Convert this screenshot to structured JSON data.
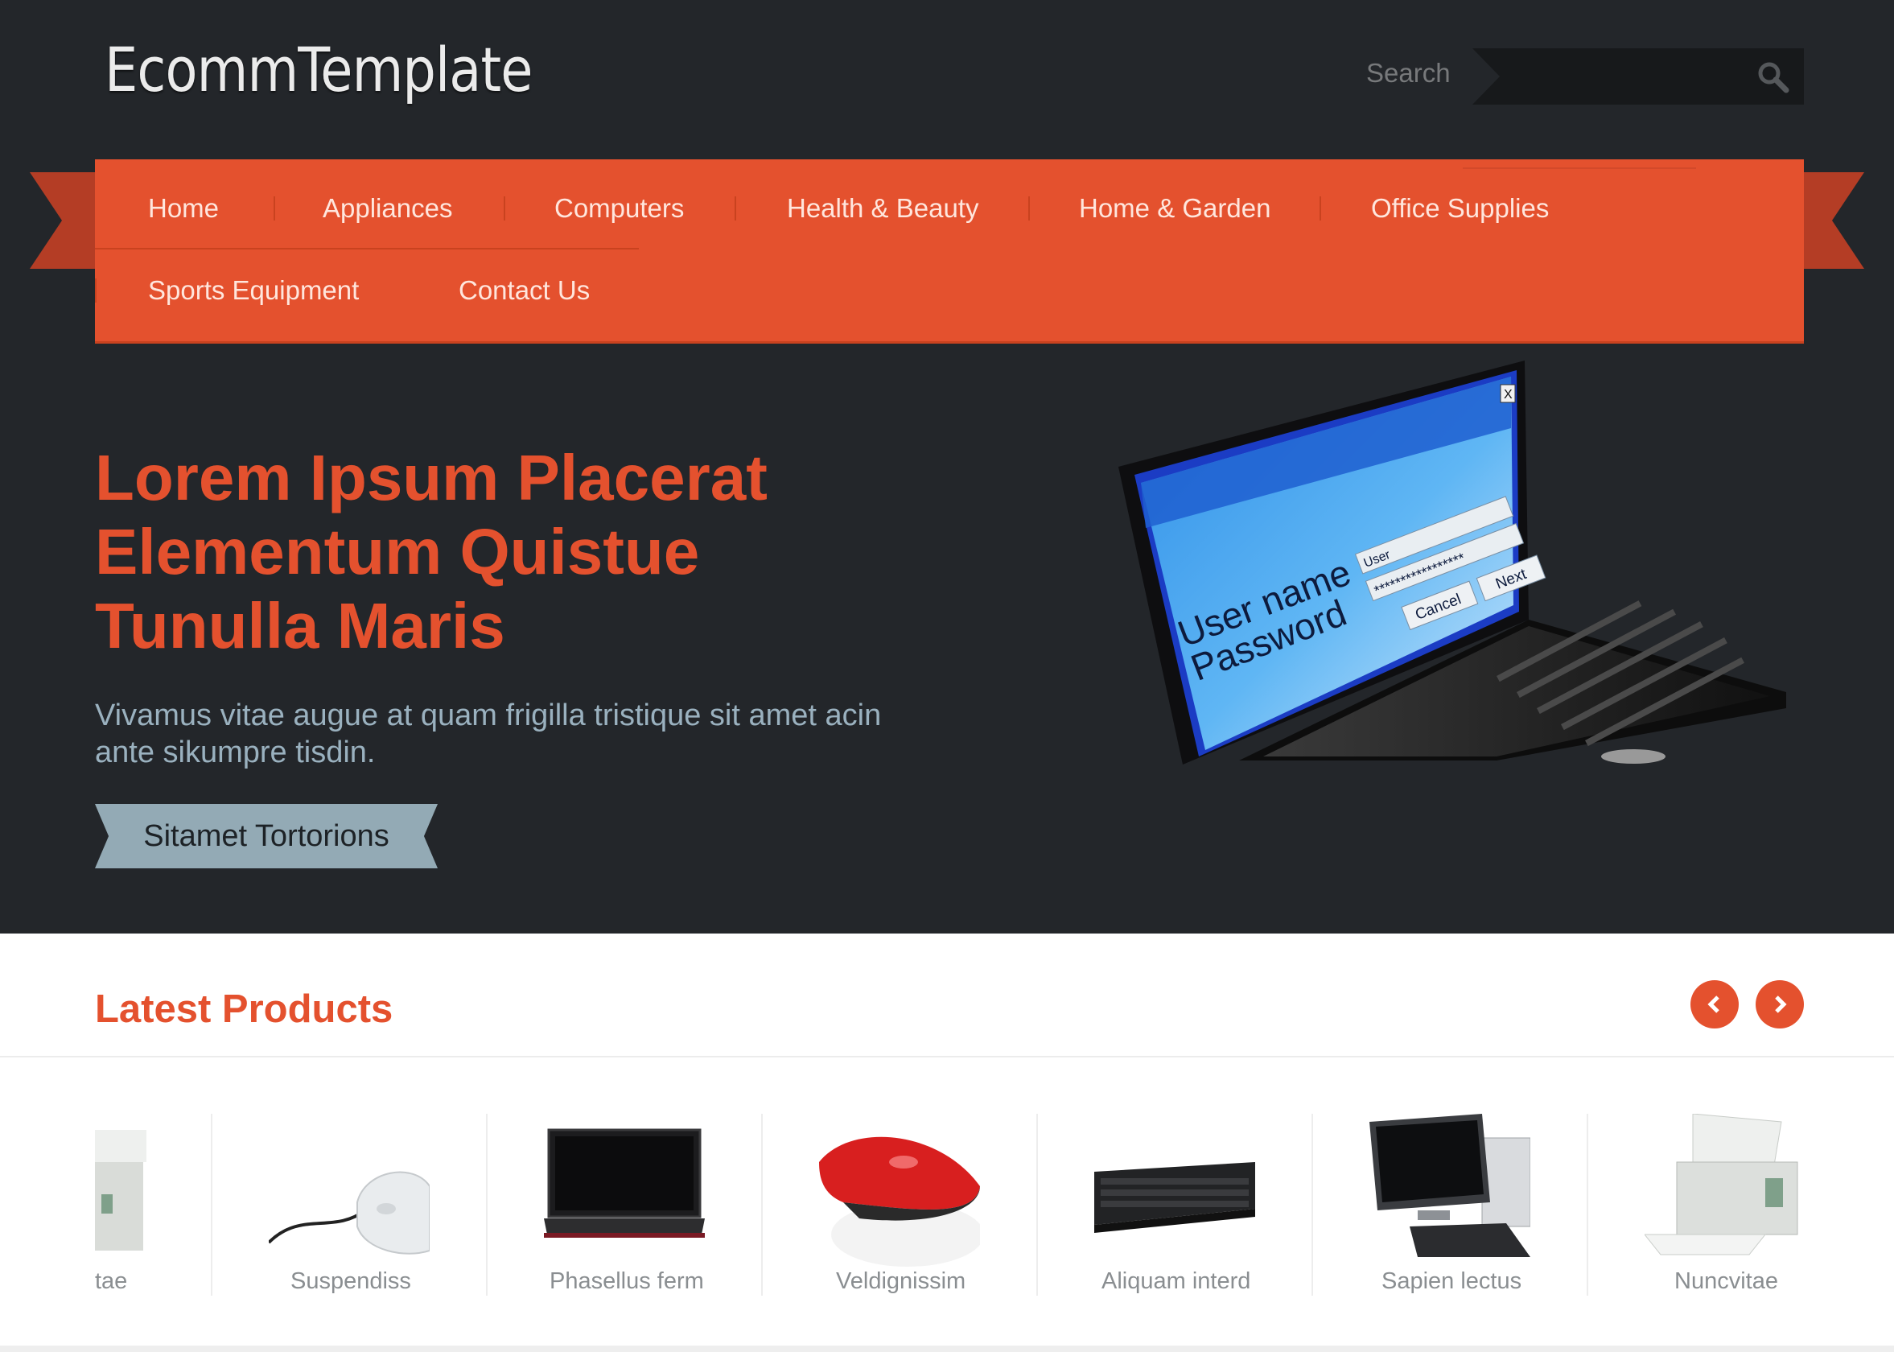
{
  "header": {
    "logo": "EcommTemplate",
    "search_label": "Search",
    "search_placeholder": ""
  },
  "nav": {
    "items": [
      "Home",
      "Appliances",
      "Computers",
      "Health & Beauty",
      "Home & Garden",
      "Office Supplies",
      "Sports Equipment",
      "Contact Us"
    ]
  },
  "hero": {
    "title": "Lorem Ipsum Placerat Elementum Quistue Tunulla Maris",
    "subtitle": "Vivamus vitae augue at quam frigilla tristique sit amet acin ante sikumpre tisdin.",
    "button_label": "Sitamet Tortorions",
    "screen_texts": {
      "user_label": "User name",
      "password_label": "Password",
      "user_value": "User",
      "password_value": "*****************",
      "cancel": "Cancel",
      "next": "Next",
      "close": "X"
    }
  },
  "latest": {
    "title": "Latest Products",
    "products": [
      "tae",
      "Suspendiss",
      "Phasellus ferm",
      "Veldignissim",
      "Aliquam interd",
      "Sapien lectus",
      "Nuncvitae"
    ]
  },
  "colors": {
    "accent": "#e4512e",
    "dark_bg": "#23262a",
    "button": "#93aab5"
  }
}
